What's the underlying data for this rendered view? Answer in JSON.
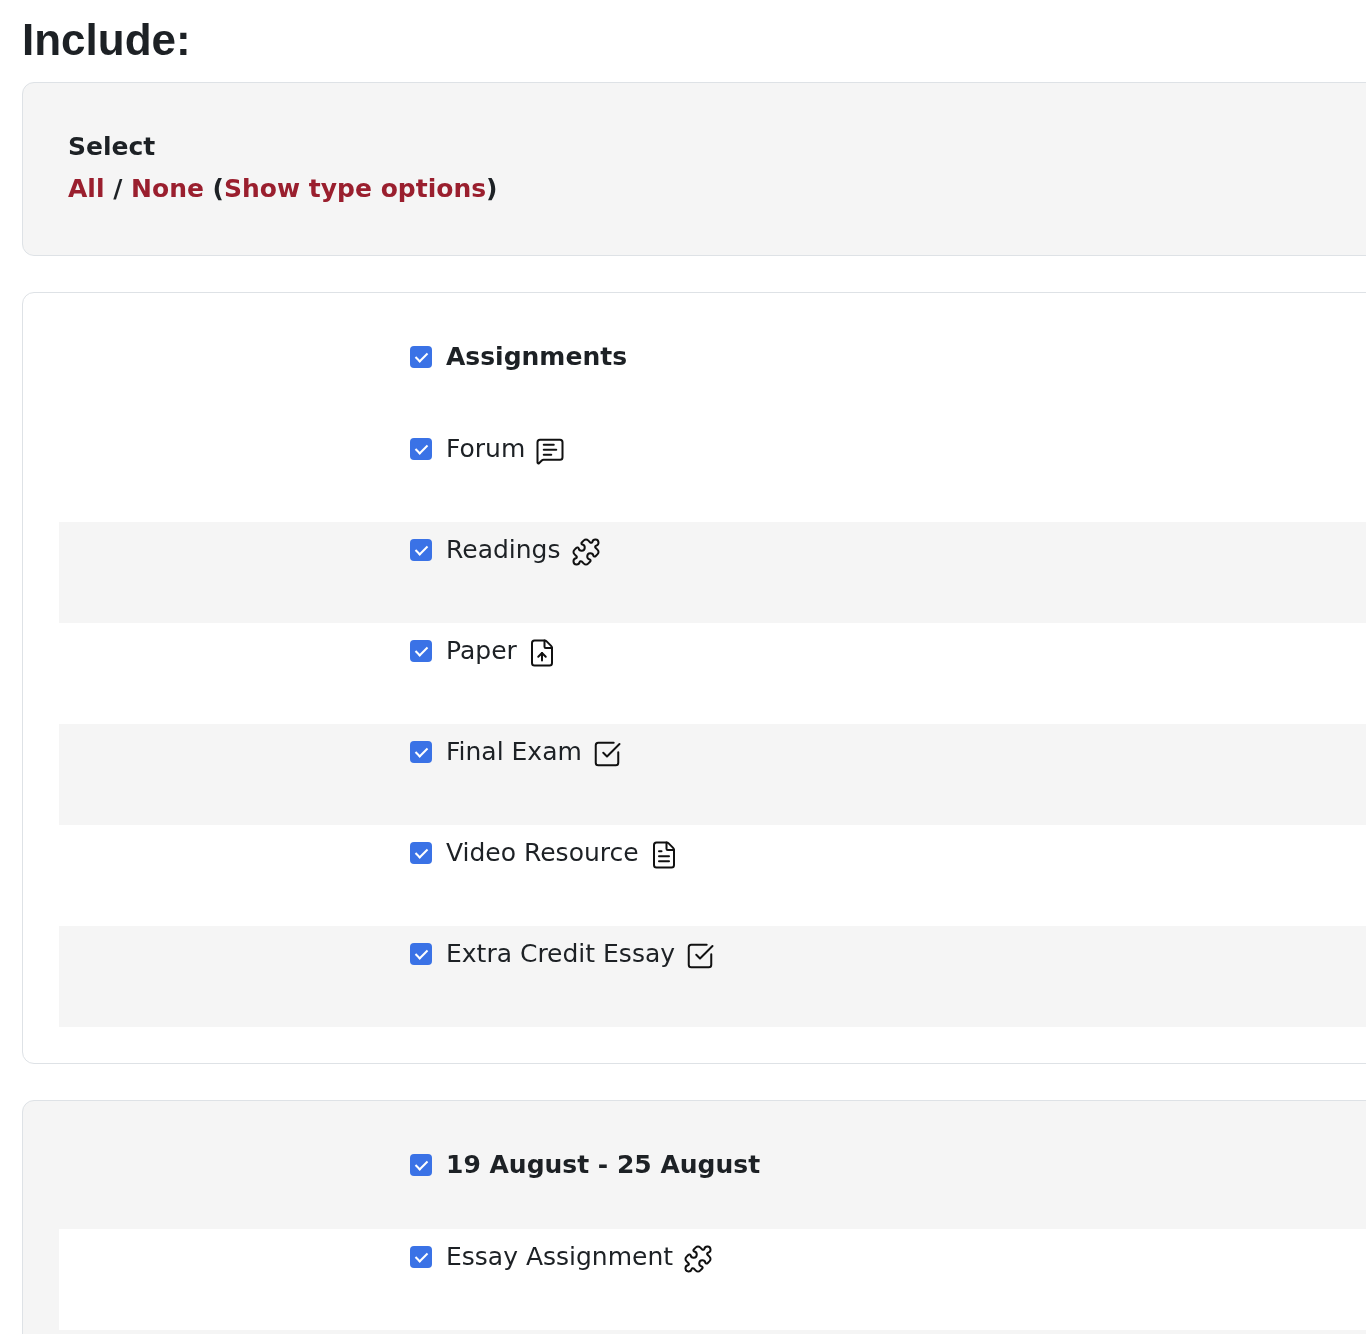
{
  "heading": "Include:",
  "select_panel": {
    "label": "Select",
    "parts": [
      {
        "kind": "link",
        "text": "All"
      },
      {
        "kind": "text",
        "text": " / "
      },
      {
        "kind": "link",
        "text": "None"
      },
      {
        "kind": "text",
        "text": " ("
      },
      {
        "kind": "link",
        "text": "Show type options"
      },
      {
        "kind": "text",
        "text": ")"
      }
    ]
  },
  "sections": [
    {
      "title": "Assignments",
      "checked": true,
      "items": [
        {
          "label": "Forum",
          "checked": true,
          "kind": "forum"
        },
        {
          "label": "Readings",
          "checked": true,
          "kind": "puzzle"
        },
        {
          "label": "Paper",
          "checked": true,
          "kind": "upload"
        },
        {
          "label": "Final Exam",
          "checked": true,
          "kind": "check"
        },
        {
          "label": "Video Resource",
          "checked": true,
          "kind": "document"
        },
        {
          "label": "Extra Credit Essay",
          "checked": true,
          "kind": "check"
        }
      ]
    },
    {
      "title": "19 August - 25 August",
      "checked": true,
      "items": [
        {
          "label": "Essay Assignment",
          "checked": true,
          "kind": "puzzle"
        }
      ]
    }
  ]
}
